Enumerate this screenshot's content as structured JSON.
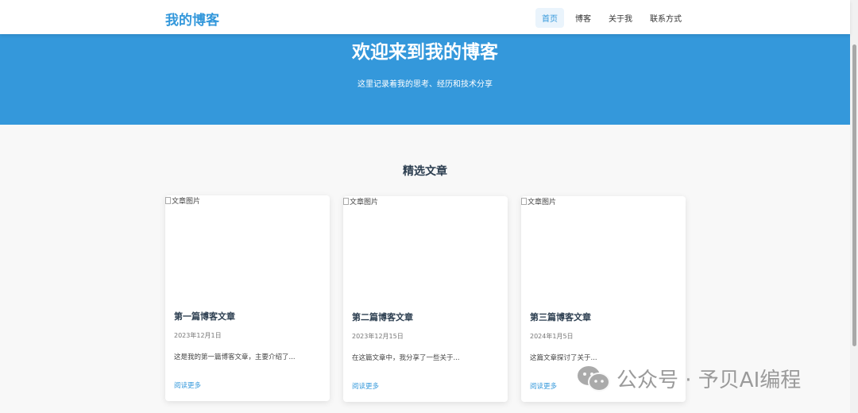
{
  "nav": {
    "logo": "我的博客",
    "items": [
      "首页",
      "博客",
      "关于我",
      "联系方式"
    ]
  },
  "hero": {
    "title": "欢迎来到我的博客",
    "subtitle": "这里记录着我的思考、经历和技术分享"
  },
  "featured": {
    "title": "精选文章",
    "img_alt": "文章图片",
    "read_more": "阅读更多",
    "cards": [
      {
        "title": "第一篇博客文章",
        "date": "2023年12月1日",
        "excerpt": "这是我的第一篇博客文章，主要介绍了..."
      },
      {
        "title": "第二篇博客文章",
        "date": "2023年12月15日",
        "excerpt": "在这篇文章中，我分享了一些关于..."
      },
      {
        "title": "第三篇博客文章",
        "date": "2024年1月5日",
        "excerpt": "这篇文章探讨了关于..."
      }
    ]
  },
  "watermark": "公众号 · 予贝AI编程"
}
